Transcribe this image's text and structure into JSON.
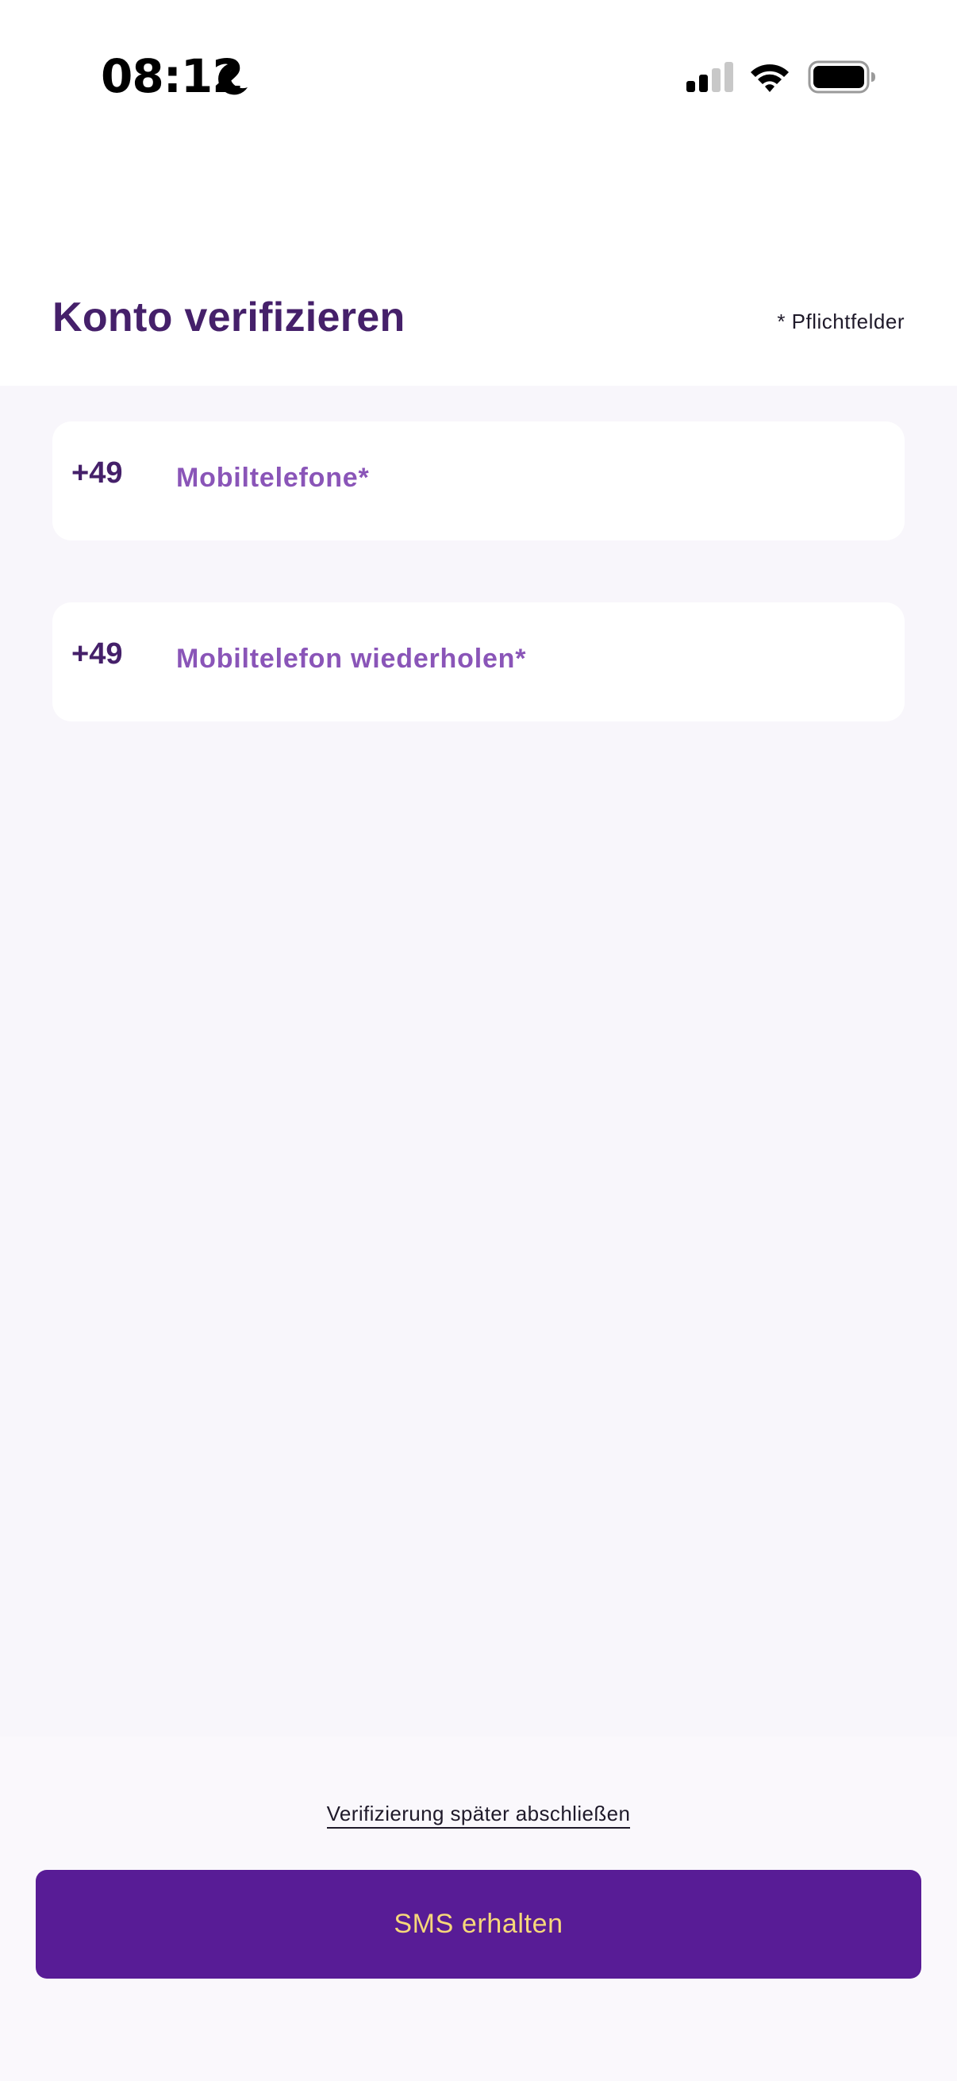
{
  "status_bar": {
    "time": "08:12",
    "icons": [
      "moon-icon",
      "signal-icon",
      "wifi-icon",
      "battery-icon"
    ]
  },
  "header": {
    "title": "Konto verifizieren",
    "required_note": "* Pflichtfelder"
  },
  "form": {
    "fields": [
      {
        "prefix": "+49",
        "label": "Mobiltelefone*"
      },
      {
        "prefix": "+49",
        "label": "Mobiltelefon wiederholen*"
      }
    ]
  },
  "footer": {
    "later_link": "Verifizierung später abschließen",
    "sms_button": "SMS erhalten"
  },
  "colors": {
    "title": "#45206a",
    "label": "#8a55b8",
    "button_bg": "#581c96",
    "button_text": "#f7d87a",
    "background": "#f8f6fb"
  }
}
